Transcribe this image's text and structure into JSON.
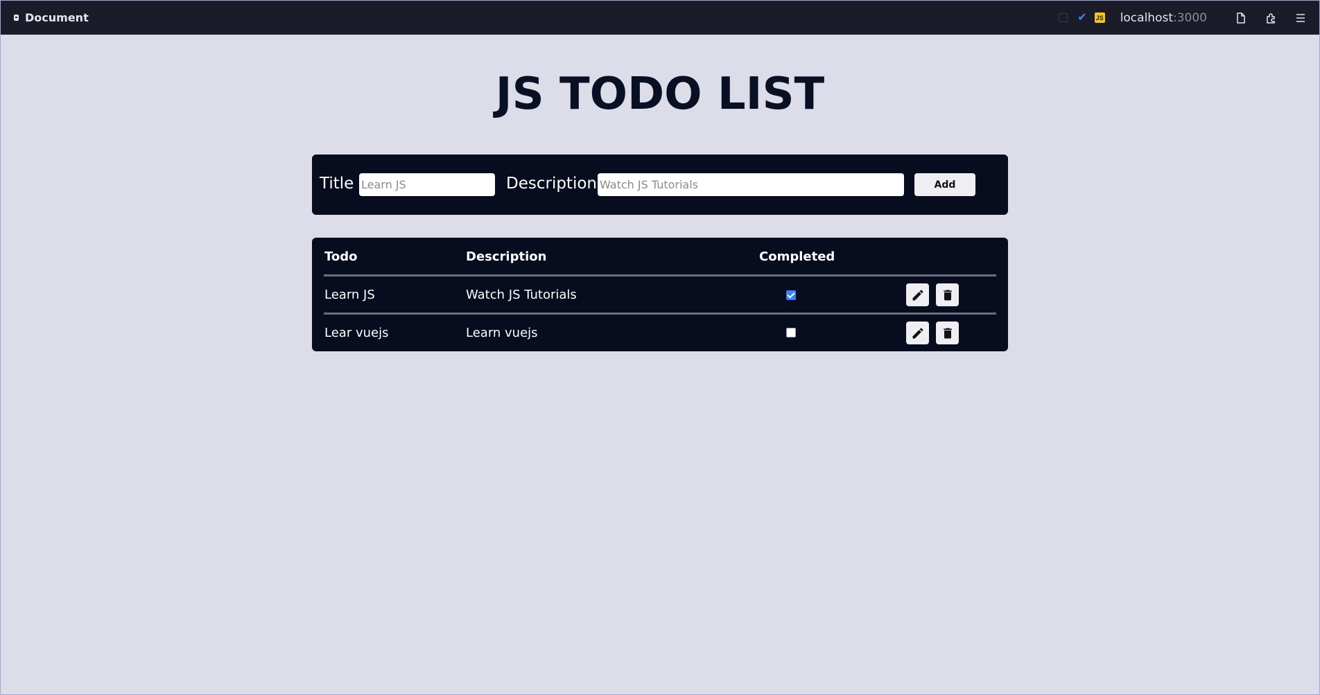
{
  "browser": {
    "tab_title": "Document",
    "url_host": "localhost",
    "url_port": ":3000",
    "extension_badge": "JS"
  },
  "page": {
    "title": "JS TODO LIST"
  },
  "form": {
    "title_label": "Title",
    "title_placeholder": "Learn JS",
    "description_label": "Description",
    "description_placeholder": "Watch JS Tutorials",
    "add_label": "Add"
  },
  "table": {
    "headers": [
      "Todo",
      "Description",
      "Completed"
    ],
    "rows": [
      {
        "todo": "Learn JS",
        "description": "Watch JS Tutorials",
        "completed": true
      },
      {
        "todo": "Lear vuejs",
        "description": "Learn vuejs",
        "completed": false
      }
    ]
  },
  "colors": {
    "page_background": "#dcdde9",
    "panel_background": "#070d1f",
    "title_color": "#0a1024",
    "checkbox_accent": "#3b82f6"
  }
}
